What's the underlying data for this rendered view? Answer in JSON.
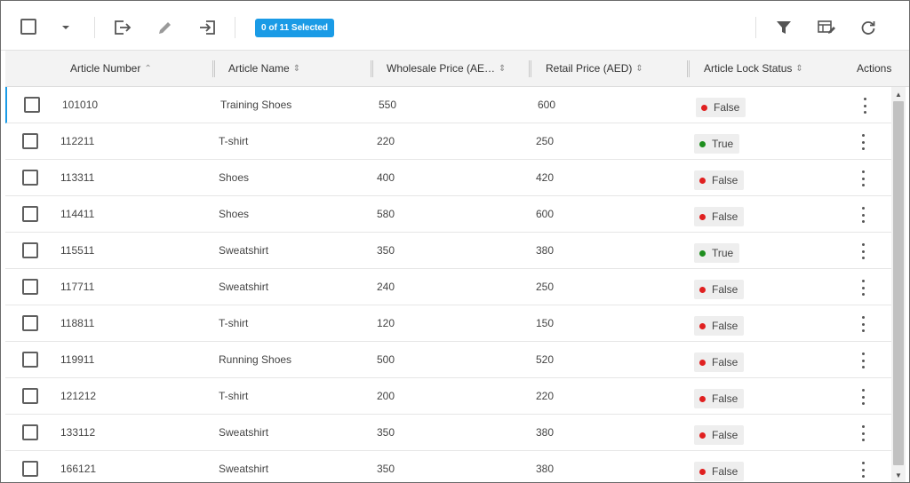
{
  "toolbar": {
    "selection_badge": "0 of 11 Selected",
    "icons": [
      "select-all-checkbox",
      "dropdown-caret",
      "export-icon",
      "edit-icon",
      "import-icon",
      "filter-icon",
      "column-settings-icon",
      "refresh-icon"
    ]
  },
  "columns": [
    {
      "key": "article_number",
      "label": "Article Number",
      "sort": "asc"
    },
    {
      "key": "article_name",
      "label": "Article Name",
      "sort": "none"
    },
    {
      "key": "wholesale_price",
      "label": "Wholesale Price (AE…",
      "sort": "none"
    },
    {
      "key": "retail_price",
      "label": "Retail Price (AED)",
      "sort": "none"
    },
    {
      "key": "lock_status",
      "label": "Article Lock Status",
      "sort": "none"
    },
    {
      "key": "actions",
      "label": "Actions",
      "sort": "none"
    }
  ],
  "rows": [
    {
      "article_number": "101010",
      "article_name": "Training Shoes",
      "wholesale_price": "550",
      "retail_price": "600",
      "lock_status": "False"
    },
    {
      "article_number": "112211",
      "article_name": "T-shirt",
      "wholesale_price": "220",
      "retail_price": "250",
      "lock_status": "True"
    },
    {
      "article_number": "113311",
      "article_name": "Shoes",
      "wholesale_price": "400",
      "retail_price": "420",
      "lock_status": "False"
    },
    {
      "article_number": "114411",
      "article_name": "Shoes",
      "wholesale_price": "580",
      "retail_price": "600",
      "lock_status": "False"
    },
    {
      "article_number": "115511",
      "article_name": "Sweatshirt",
      "wholesale_price": "350",
      "retail_price": "380",
      "lock_status": "True"
    },
    {
      "article_number": "117711",
      "article_name": "Sweatshirt",
      "wholesale_price": "240",
      "retail_price": "250",
      "lock_status": "False"
    },
    {
      "article_number": "118811",
      "article_name": "T-shirt",
      "wholesale_price": "120",
      "retail_price": "150",
      "lock_status": "False"
    },
    {
      "article_number": "119911",
      "article_name": "Running Shoes",
      "wholesale_price": "500",
      "retail_price": "520",
      "lock_status": "False"
    },
    {
      "article_number": "121212",
      "article_name": "T-shirt",
      "wholesale_price": "200",
      "retail_price": "220",
      "lock_status": "False"
    },
    {
      "article_number": "133112",
      "article_name": "Sweatshirt",
      "wholesale_price": "350",
      "retail_price": "380",
      "lock_status": "False"
    },
    {
      "article_number": "166121",
      "article_name": "Sweatshirt",
      "wholesale_price": "350",
      "retail_price": "380",
      "lock_status": "False"
    }
  ],
  "colors": {
    "accent": "#1a9be6",
    "status_false": "#e02020",
    "status_true": "#1e8e1e"
  }
}
